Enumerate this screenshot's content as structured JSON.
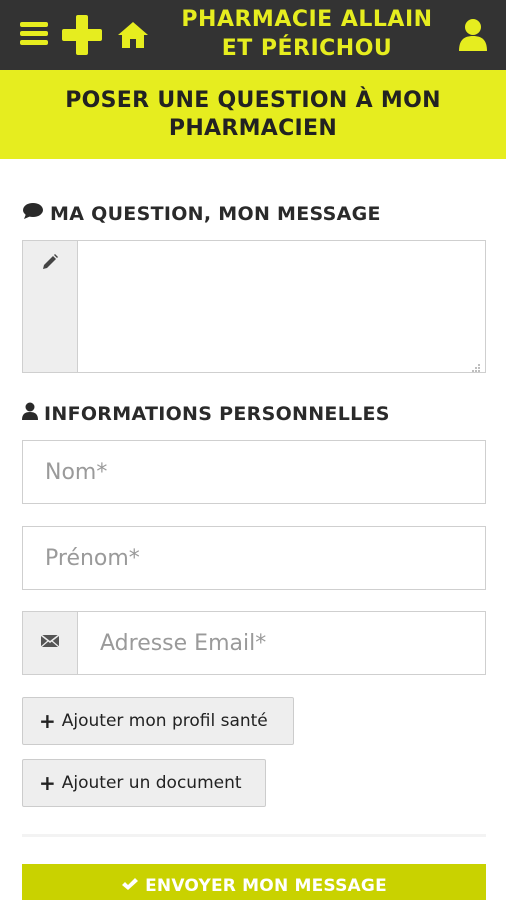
{
  "header": {
    "brand_line1": "PHARMACIE ALLAIN",
    "brand_line2": "ET PÉRICHOU",
    "icons": [
      "menu-icon",
      "pharmacy-cross-icon",
      "home-icon",
      "user-icon"
    ]
  },
  "banner": {
    "title": "POSER UNE QUESTION À MON PHARMACIEN"
  },
  "question_section": {
    "title": "MA QUESTION, MON MESSAGE",
    "icon": "comment-icon",
    "message_value": "",
    "message_placeholder": "",
    "addon_icon": "pencil-icon"
  },
  "personal_section": {
    "title": "INFORMATIONS PERSONNELLES",
    "icon": "user-icon",
    "fields": {
      "nom_placeholder": "Nom*",
      "nom_value": "",
      "prenom_placeholder": "Prénom*",
      "prenom_value": "",
      "email_placeholder": "Adresse Email*",
      "email_value": "",
      "email_icon": "envelope-icon"
    }
  },
  "buttons": {
    "add_profile": "Ajouter mon profil santé",
    "add_document": "Ajouter un document",
    "submit": "ENVOYER MON MESSAGE"
  },
  "colors": {
    "accent_yellow": "#e6ed1f",
    "topbar_dark": "#333333",
    "submit_green": "#c9d200"
  }
}
